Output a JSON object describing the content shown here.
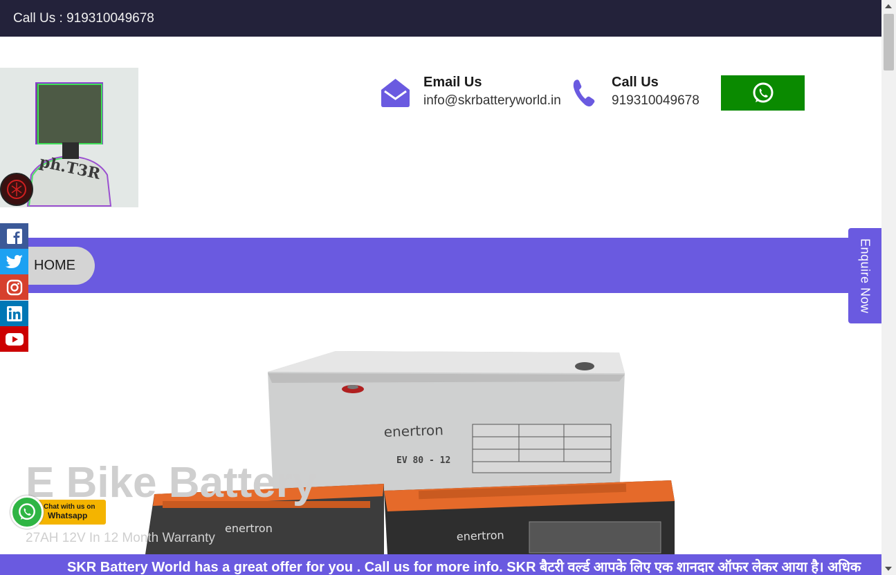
{
  "topbar": {
    "call_text": "Call Us : 919310049678"
  },
  "logo": {
    "text": "ph.T3R"
  },
  "header": {
    "email": {
      "title": "Email Us",
      "value": "info@skrbatteryworld.in"
    },
    "call": {
      "title": "Call Us",
      "value": "919310049678"
    }
  },
  "nav": {
    "home": "HOME"
  },
  "enquire": {
    "label": "Enquire Now"
  },
  "hero": {
    "title": "E Bike Battery",
    "subtitle": "27AH 12V In 12 Month Warranty",
    "battery_brand": "enertron",
    "battery_model": "EV 80 - 12"
  },
  "chat_badge": {
    "line1": "Chat with us on",
    "line2": "Whatsapp"
  },
  "marquee": {
    "text": "SKR Battery World has a great offer for you . Call us for more info. SKR बैटरी वर्ल्ड आपके लिए एक शानदार ऑफर लेकर आया है। अधिक"
  },
  "colors": {
    "topbar": "#23223a",
    "accent": "#6a5ae0",
    "whatsapp": "#0a8a00",
    "facebook": "#3b5998",
    "twitter": "#1da1f2",
    "instagram": "#d6402d",
    "linkedin": "#0077b5",
    "youtube": "#cc0000"
  },
  "social": [
    "facebook-icon",
    "twitter-icon",
    "instagram-icon",
    "linkedin-icon",
    "youtube-icon"
  ]
}
